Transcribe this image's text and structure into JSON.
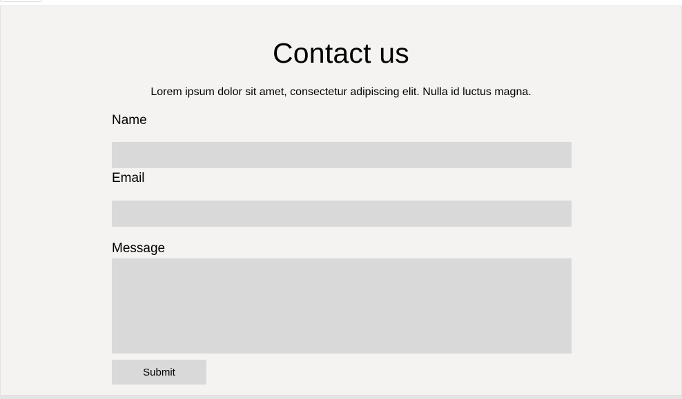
{
  "page": {
    "title": "Contact us",
    "subtitle": "Lorem ipsum dolor sit amet, consectetur adipiscing elit. Nulla id luctus magna."
  },
  "form": {
    "name": {
      "label": "Name",
      "value": "",
      "placeholder": ""
    },
    "email": {
      "label": "Email",
      "value": "",
      "placeholder": ""
    },
    "message": {
      "label": "Message",
      "value": "",
      "placeholder": ""
    },
    "submit_label": "Submit"
  },
  "colors": {
    "background": "#f4f3f1",
    "field": "#d9d9d9",
    "text": "#000000"
  }
}
